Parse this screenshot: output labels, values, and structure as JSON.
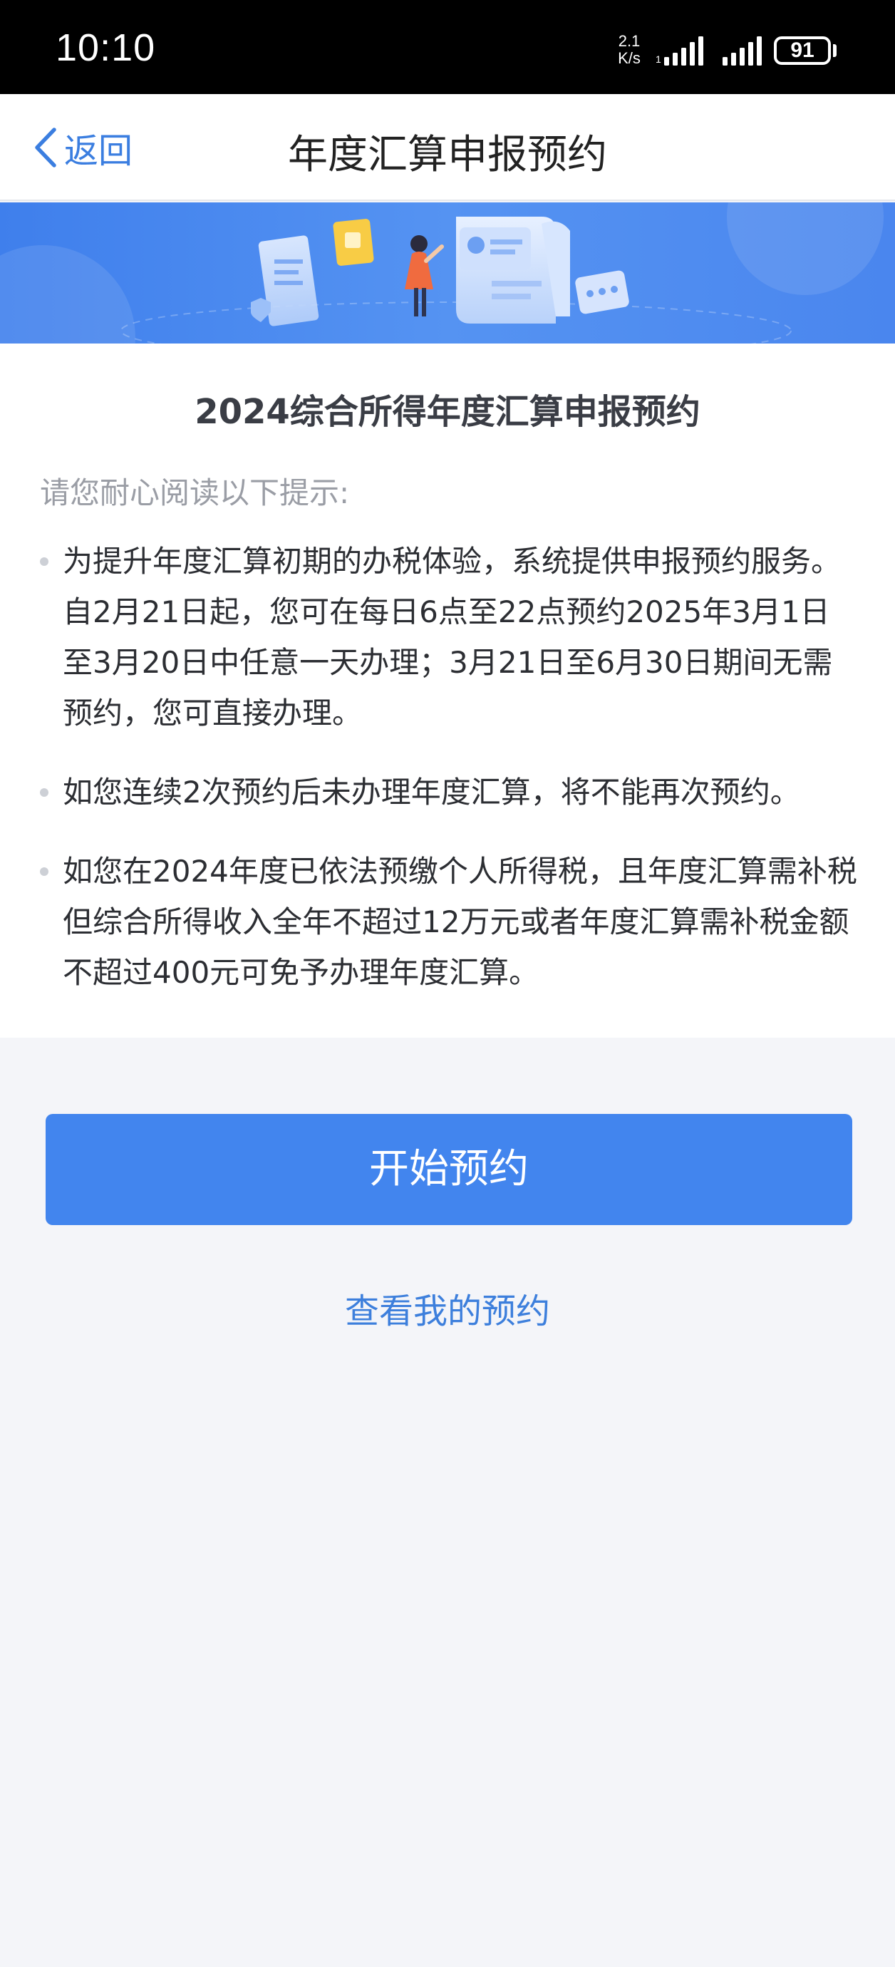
{
  "status_bar": {
    "time": "10:10",
    "net_speed_value": "2.1",
    "net_speed_unit": "K/s",
    "battery": "91"
  },
  "nav": {
    "back_label": "返回",
    "title": "年度汇算申报预约"
  },
  "content": {
    "heading": "2024综合所得年度汇算申报预约",
    "hint_label": "请您耐心阅读以下提示:",
    "tips": [
      "为提升年度汇算初期的办税体验，系统提供申报预约服务。自2月21日起，您可在每日6点至22点预约2025年3月1日至3月20日中任意一天办理；3月21日至6月30日期间无需预约，您可直接办理。",
      "如您连续2次预约后未办理年度汇算，将不能再次预约。",
      "如您在2024年度已依法预缴个人所得税，且年度汇算需补税但综合所得收入全年不超过12万元或者年度汇算需补税金额不超过400元可免予办理年度汇算。"
    ]
  },
  "actions": {
    "primary_label": "开始预约",
    "secondary_label": "查看我的预约"
  },
  "colors": {
    "accent": "#4285ee",
    "link": "#3d7fdc",
    "page_bg": "#f4f5f9",
    "banner_blue": "#4a8af0"
  },
  "icons": {
    "back": "chevron-left-icon",
    "signal": "signal-bars-icon",
    "battery": "battery-icon"
  }
}
